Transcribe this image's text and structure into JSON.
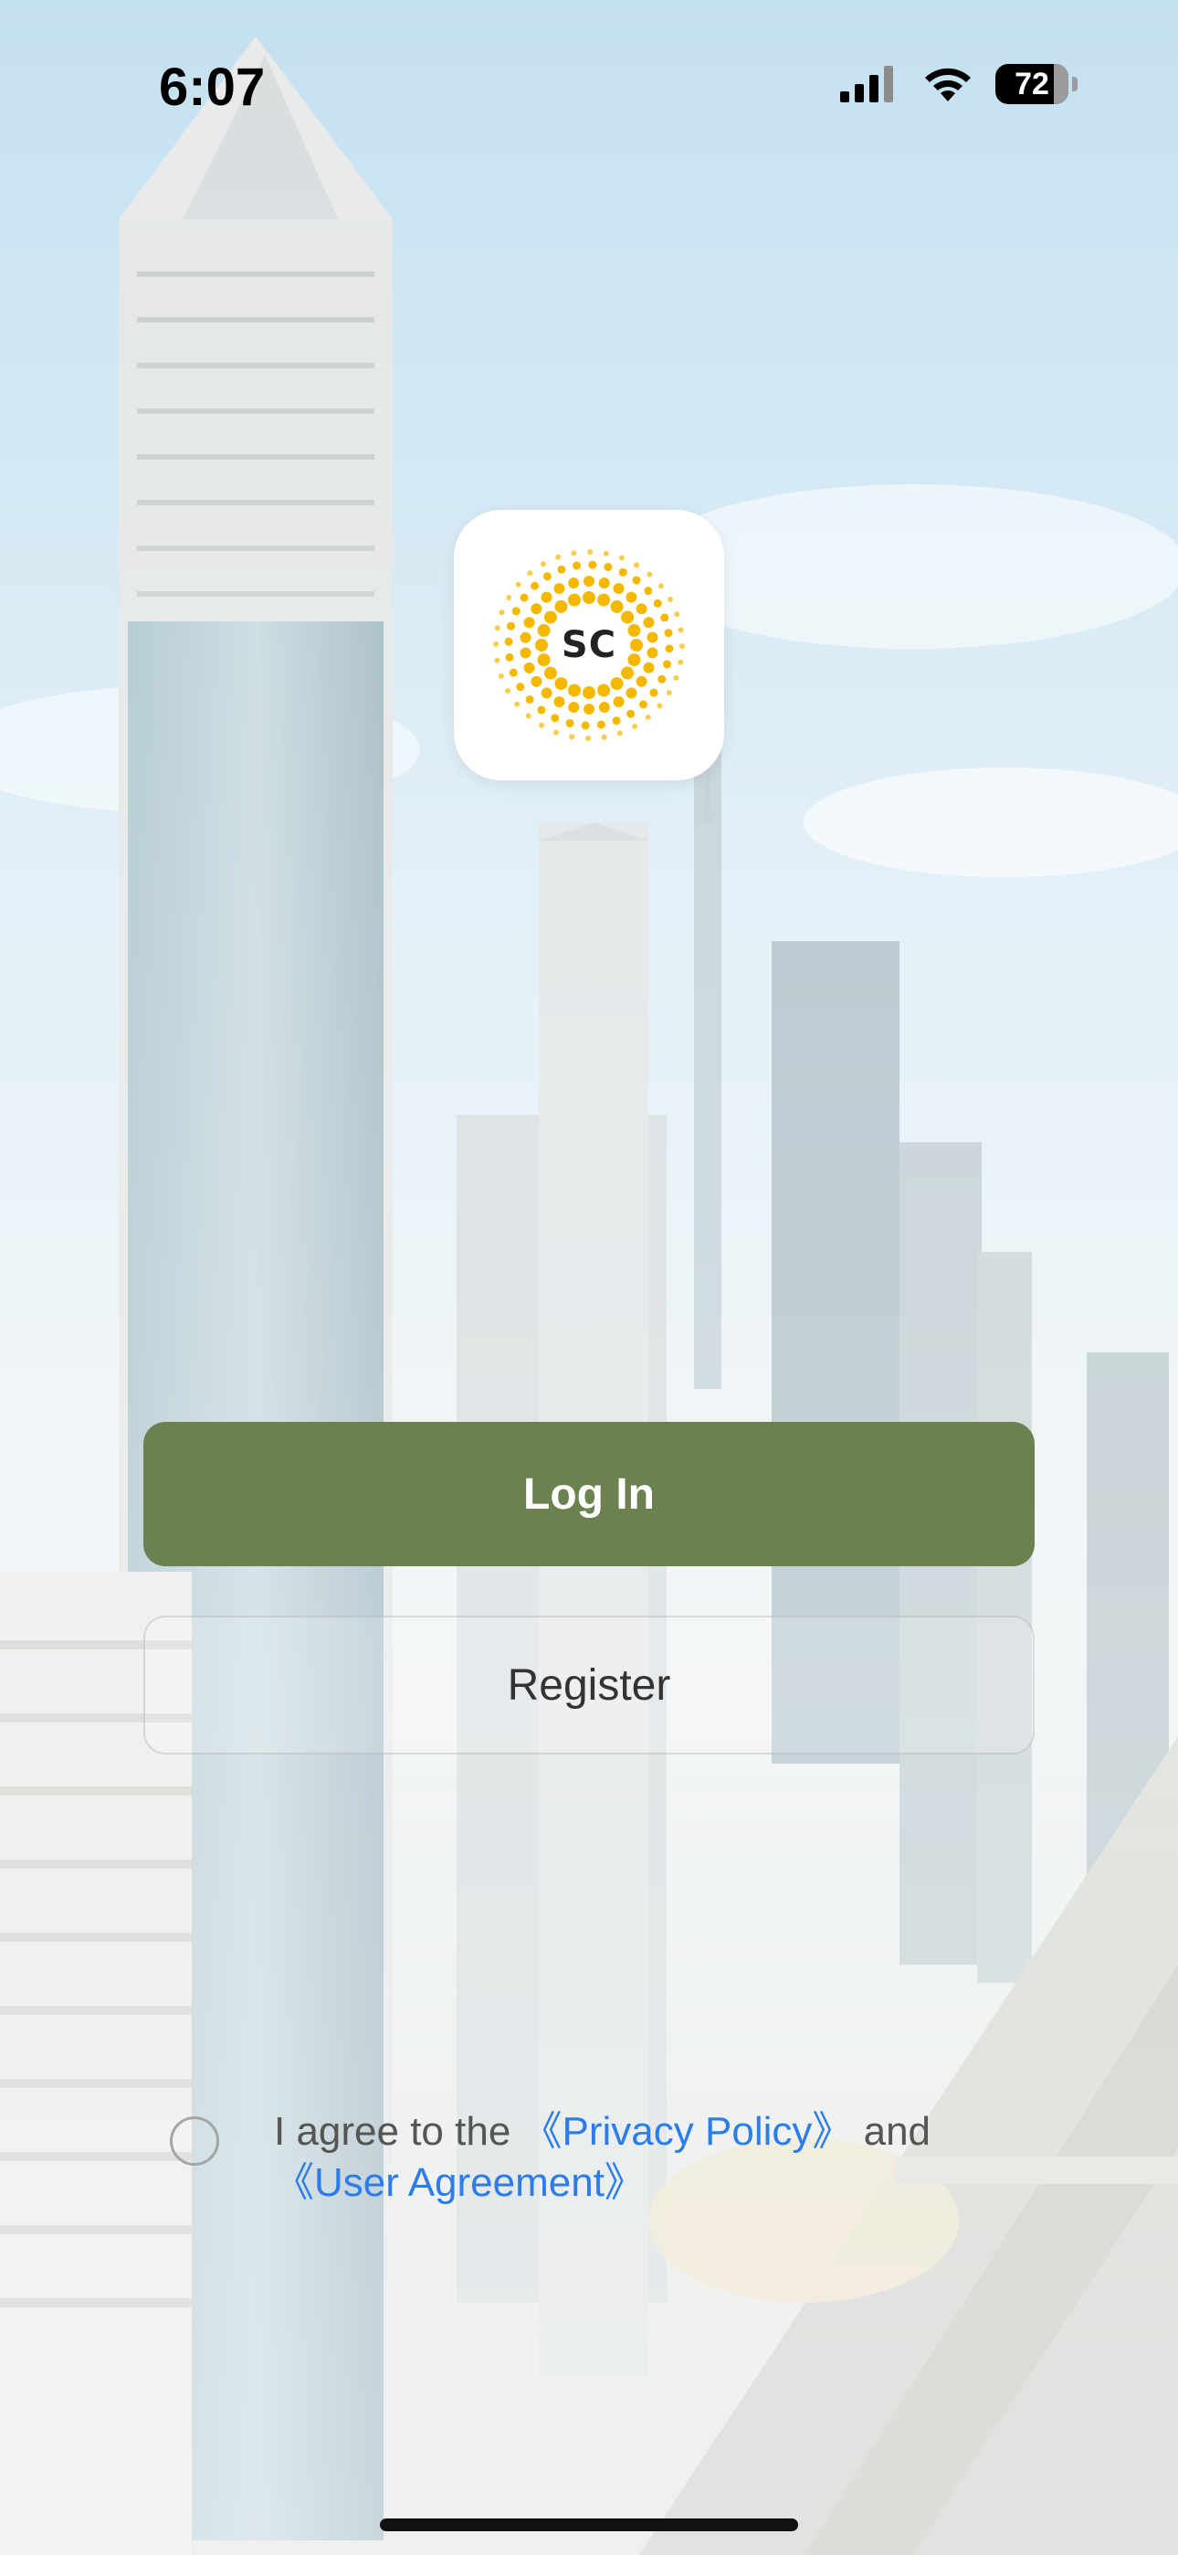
{
  "status_bar": {
    "time": "6:07",
    "battery": "72"
  },
  "logo": {
    "text": "SC"
  },
  "buttons": {
    "login": "Log In",
    "register": "Register"
  },
  "agreement": {
    "prefix": "I agree to the ",
    "privacy_link": "《Privacy Policy》",
    "middle": " and ",
    "user_link": "《User Agreement》"
  },
  "colors": {
    "primary": "#6b8150",
    "link": "#2b7de9",
    "logo_accent": "#f5b800"
  }
}
